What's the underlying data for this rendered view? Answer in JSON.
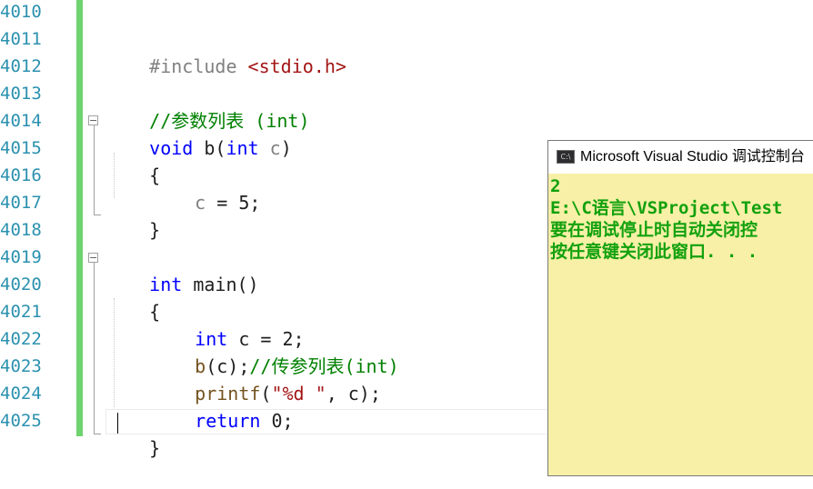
{
  "editor": {
    "line_numbers": [
      "4010",
      "4011",
      "4012",
      "4013",
      "4014",
      "4015",
      "4016",
      "4017",
      "4018",
      "4019",
      "4020",
      "4021",
      "4022",
      "4023",
      "4024",
      "4025"
    ],
    "code": {
      "include_directive": "#include",
      "include_header": "<stdio.h>",
      "comment_param_list": "//参数列表 (int)",
      "void_kw": "void",
      "b_name": " b(",
      "int_kw_param": "int",
      "c_param": " c",
      "close_paren_b": ")",
      "open_brace_1": "{",
      "c_var": "c",
      "assign_five": " = 5;",
      "close_brace_1": "}",
      "int_kw_main": "int",
      "main_sig": " main()",
      "open_brace_2": "{",
      "int_kw_decl": "int",
      "decl_rest": " c = 2;",
      "call_b": "b",
      "call_b_args": "(c);",
      "comment_pass": "//传参列表(int)",
      "printf_fn": "printf",
      "printf_open": "(",
      "printf_format": "\"%d \"",
      "printf_rest": ", c);",
      "return_kw": "return",
      "return_rest": " 0;",
      "close_brace_2": "}"
    }
  },
  "console": {
    "title": "Microsoft Visual Studio 调试控制台",
    "icon": "console-app-icon",
    "output_lines": [
      "2",
      "E:\\C语言\\VSProject\\Test",
      "要在调试停止时自动关闭控",
      "按任意键关闭此窗口. . ."
    ],
    "colors": {
      "background": "#f7f0a6",
      "text": "#13a10e"
    }
  },
  "colors": {
    "keyword": "#0000ff",
    "comment": "#008000",
    "string": "#a31515",
    "line_number": "#2b91af",
    "change_bar": "#6fd36f"
  }
}
